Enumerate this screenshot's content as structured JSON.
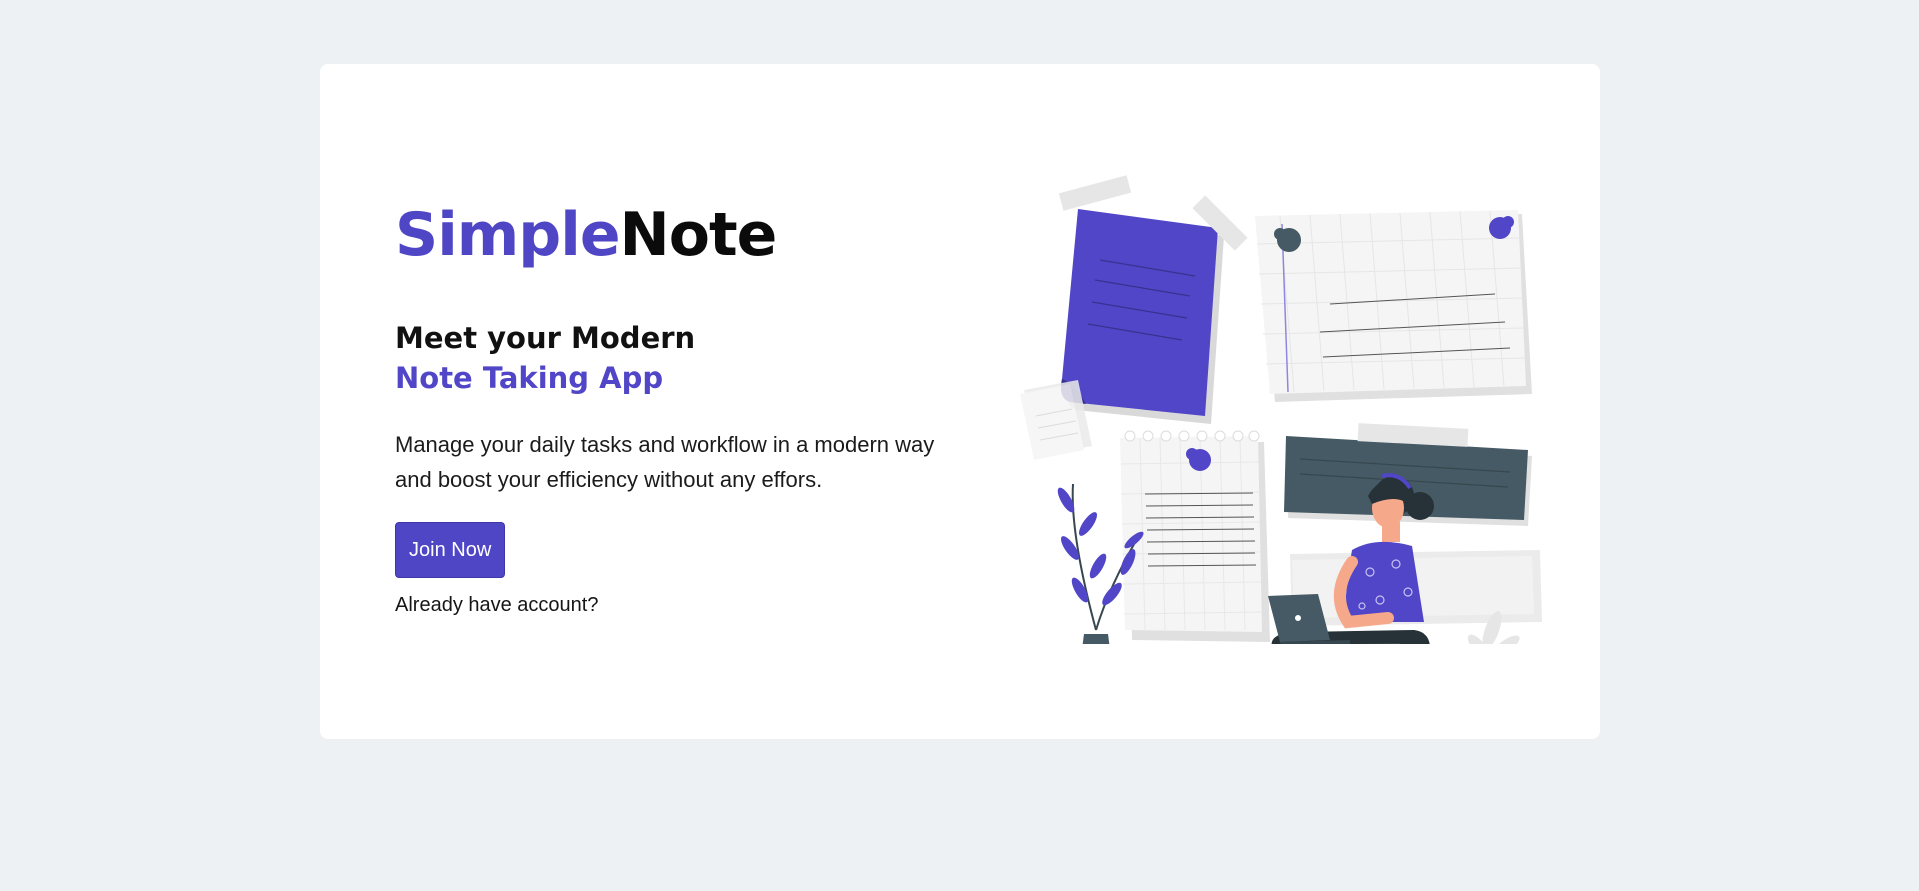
{
  "brand": {
    "part1": "Simple",
    "part2": "Note"
  },
  "hero": {
    "headline_line1": "Meet your Modern",
    "headline_line2": "Note Taking App",
    "description": "Manage your daily tasks and workflow in a modern way and boost your efficiency without any effors.",
    "cta_label": "Join Now",
    "login_text": "Already have account?"
  },
  "illustration": {
    "subject": "woman-with-laptop-and-notes-illustration"
  },
  "colors": {
    "background": "#edf1f4",
    "card": "#ffffff",
    "accent": "#4f46c6",
    "dark": "#455a64"
  }
}
